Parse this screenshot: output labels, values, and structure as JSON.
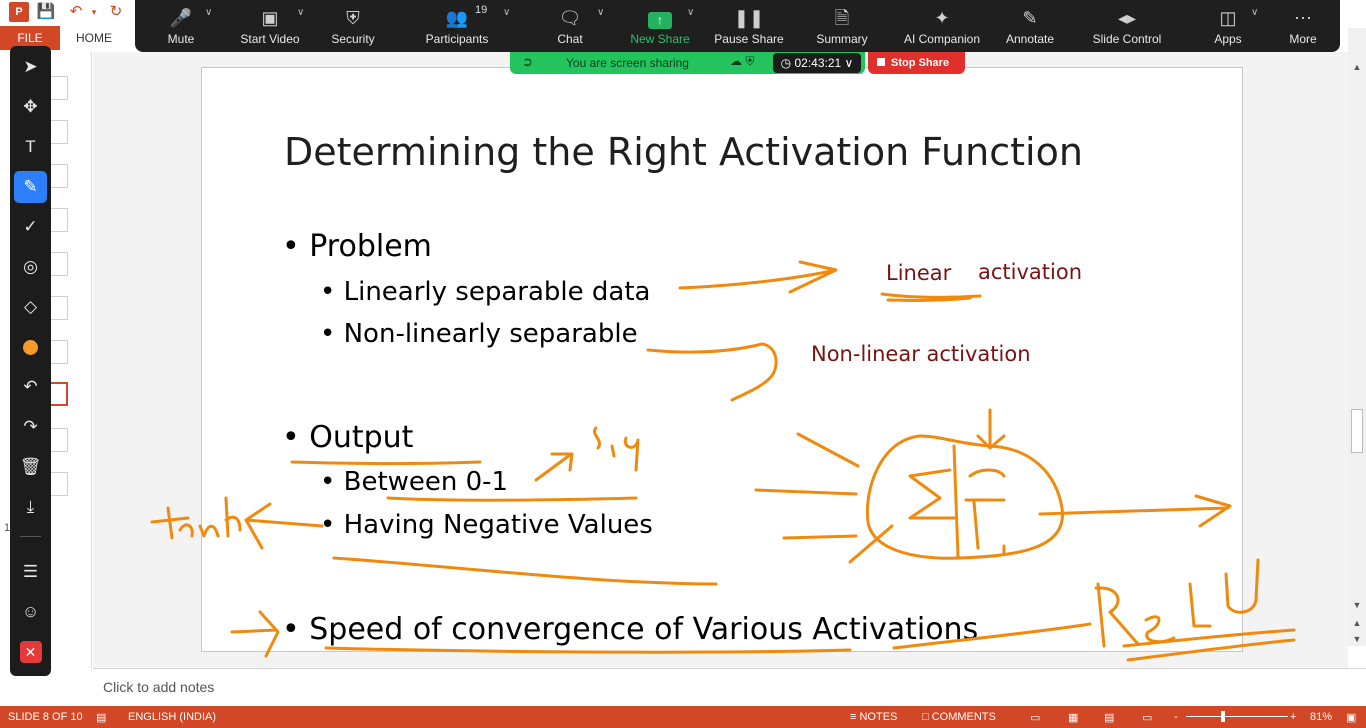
{
  "ppt": {
    "logo_letter": "P",
    "file_tab": "FILE",
    "home_tab": "HOME",
    "quick_access": [
      "save-icon",
      "undo-icon",
      "redo-icon"
    ]
  },
  "zoom_toolbar": {
    "mute": "Mute",
    "start_video": "Start Video",
    "security": "Security",
    "participants": "Participants",
    "participant_count": "19",
    "chat": "Chat",
    "new_share": "New Share",
    "pause_share": "Pause Share",
    "summary": "Summary",
    "ai_companion": "AI Companion",
    "annotate": "Annotate",
    "slide_control": "Slide Control",
    "apps": "Apps",
    "more": "More"
  },
  "sharing": {
    "status": "You are screen sharing",
    "timer": "02:43:21",
    "stop": "Stop Share"
  },
  "annotation_tools": [
    "select-icon",
    "move-icon",
    "text-icon",
    "pen-icon",
    "stamp-check-icon",
    "spotlight-icon",
    "eraser-icon",
    "color-icon",
    "undo-icon",
    "redo-icon",
    "delete-icon",
    "save-icon",
    "menu-icon",
    "participant-annotator-icon",
    "close-annotation-icon"
  ],
  "active_tool": "pen-icon",
  "ink_color": "#f08a0f",
  "slide": {
    "title": "Determining the Right Activation Function",
    "bullets": {
      "problem": "Problem",
      "linear": "Linearly separable data",
      "nonlinear": "Non-linearly separable",
      "output": "Output",
      "between": "Between 0-1",
      "negative": "Having Negative Values",
      "speed": "Speed of convergence of Various Activations"
    },
    "annotations": {
      "linear": "Linear",
      "activation": "activation",
      "nonlinear_activation": "Non-linear activation"
    }
  },
  "left_number": "1",
  "notes": {
    "placeholder": "Click to add notes"
  },
  "status_bar": {
    "slide": "SLIDE 8 OF 10",
    "language": "ENGLISH (INDIA)",
    "notes": "NOTES",
    "comments": "COMMENTS",
    "zoom": "81%",
    "zoom_minus": "-",
    "zoom_plus": "+"
  },
  "colors": {
    "ppt_accent": "#d24726",
    "zoom_bg": "#1f1f1f",
    "share_green": "#23c45e",
    "stop_red": "#e0302c",
    "annotation_text": "#7a1212"
  }
}
